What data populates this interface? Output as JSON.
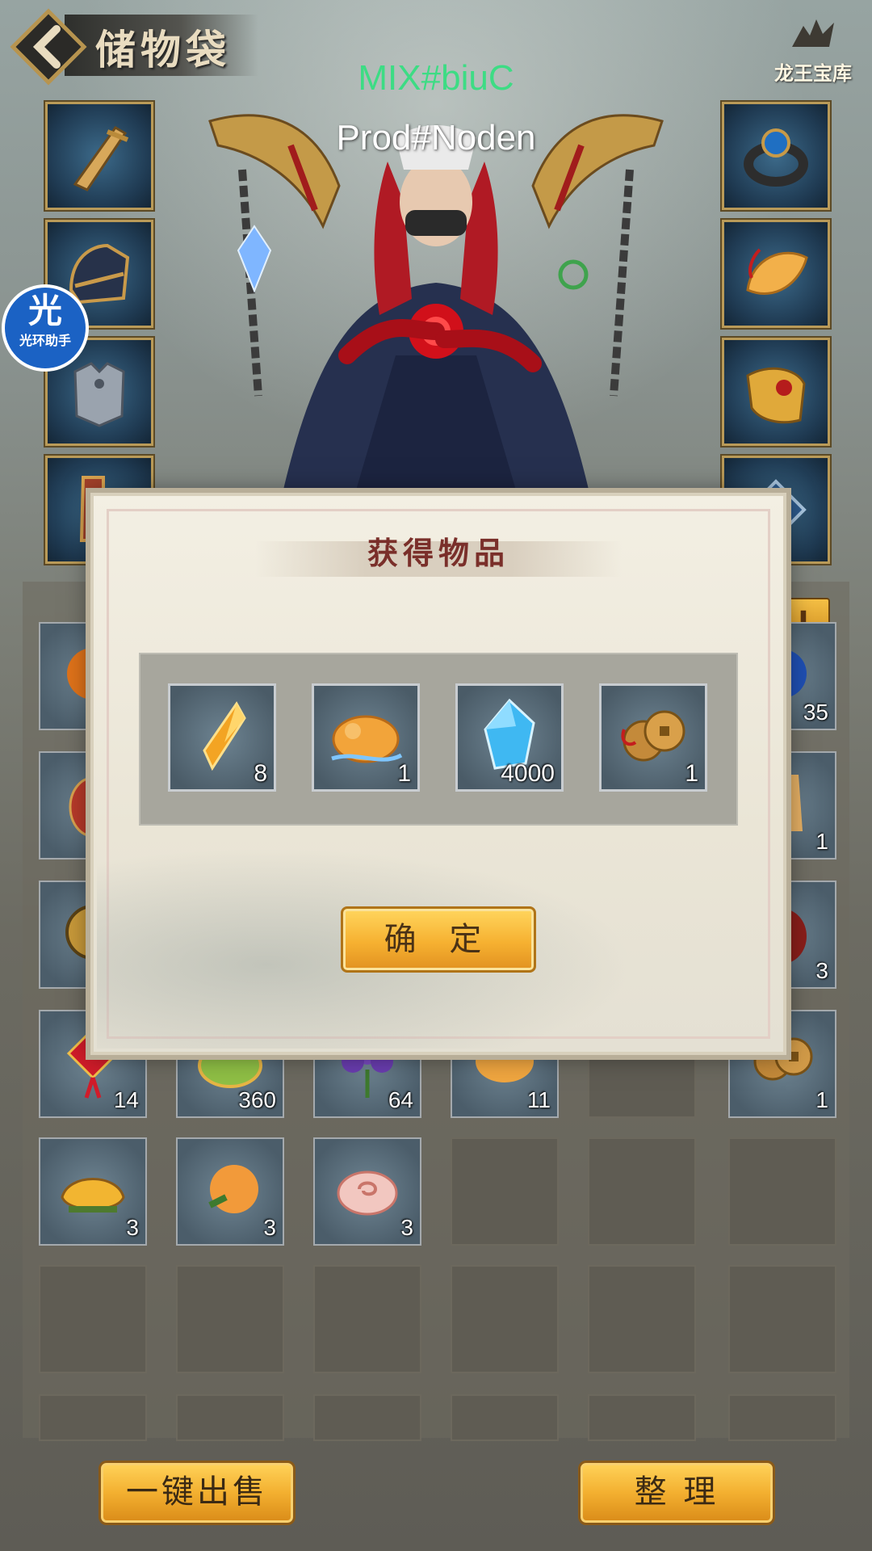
{
  "header": {
    "title": "储物袋",
    "brand": "龙王宝库"
  },
  "watermark": {
    "line1": "MIX#biuC",
    "line2": "Prod#Noden"
  },
  "helper": {
    "big": "光",
    "small": "光环助手"
  },
  "equipment": {
    "left": [
      {
        "name": "weapon-slot",
        "icon": "golden-blade-icon"
      },
      {
        "name": "helmet-slot",
        "icon": "helmet-icon"
      },
      {
        "name": "armor-slot",
        "icon": "armor-icon"
      },
      {
        "name": "boots-slot",
        "icon": "boots-icon"
      }
    ],
    "right": [
      {
        "name": "ring-slot",
        "icon": "ring-icon"
      },
      {
        "name": "jade-slot",
        "icon": "jade-pendant-icon"
      },
      {
        "name": "bracer-slot",
        "icon": "bracer-icon"
      },
      {
        "name": "amulet-slot",
        "icon": "amulet-icon"
      }
    ]
  },
  "inventory": {
    "visible_counts": {
      "r1c6": "35",
      "r2c6": "1",
      "r3c6": "3",
      "r4": [
        "14",
        "360",
        "64",
        "11",
        "",
        "1"
      ],
      "r5": [
        "3",
        "3",
        "3",
        "",
        "",
        ""
      ]
    }
  },
  "buttons": {
    "sell_all": "一键出售",
    "sort": "整 理",
    "plus": "+"
  },
  "modal": {
    "title": "获得物品",
    "rewards": [
      {
        "icon": "crystal-shard-icon",
        "count": "8"
      },
      {
        "icon": "golden-ox-icon",
        "count": "1"
      },
      {
        "icon": "blue-gem-icon",
        "count": "4000"
      },
      {
        "icon": "copper-coins-icon",
        "count": "1"
      }
    ],
    "confirm": "确 定"
  },
  "colors": {
    "accent_gold": "#f3b030",
    "title_red": "#7a2f2a",
    "watermark_green": "#3ddc84"
  }
}
